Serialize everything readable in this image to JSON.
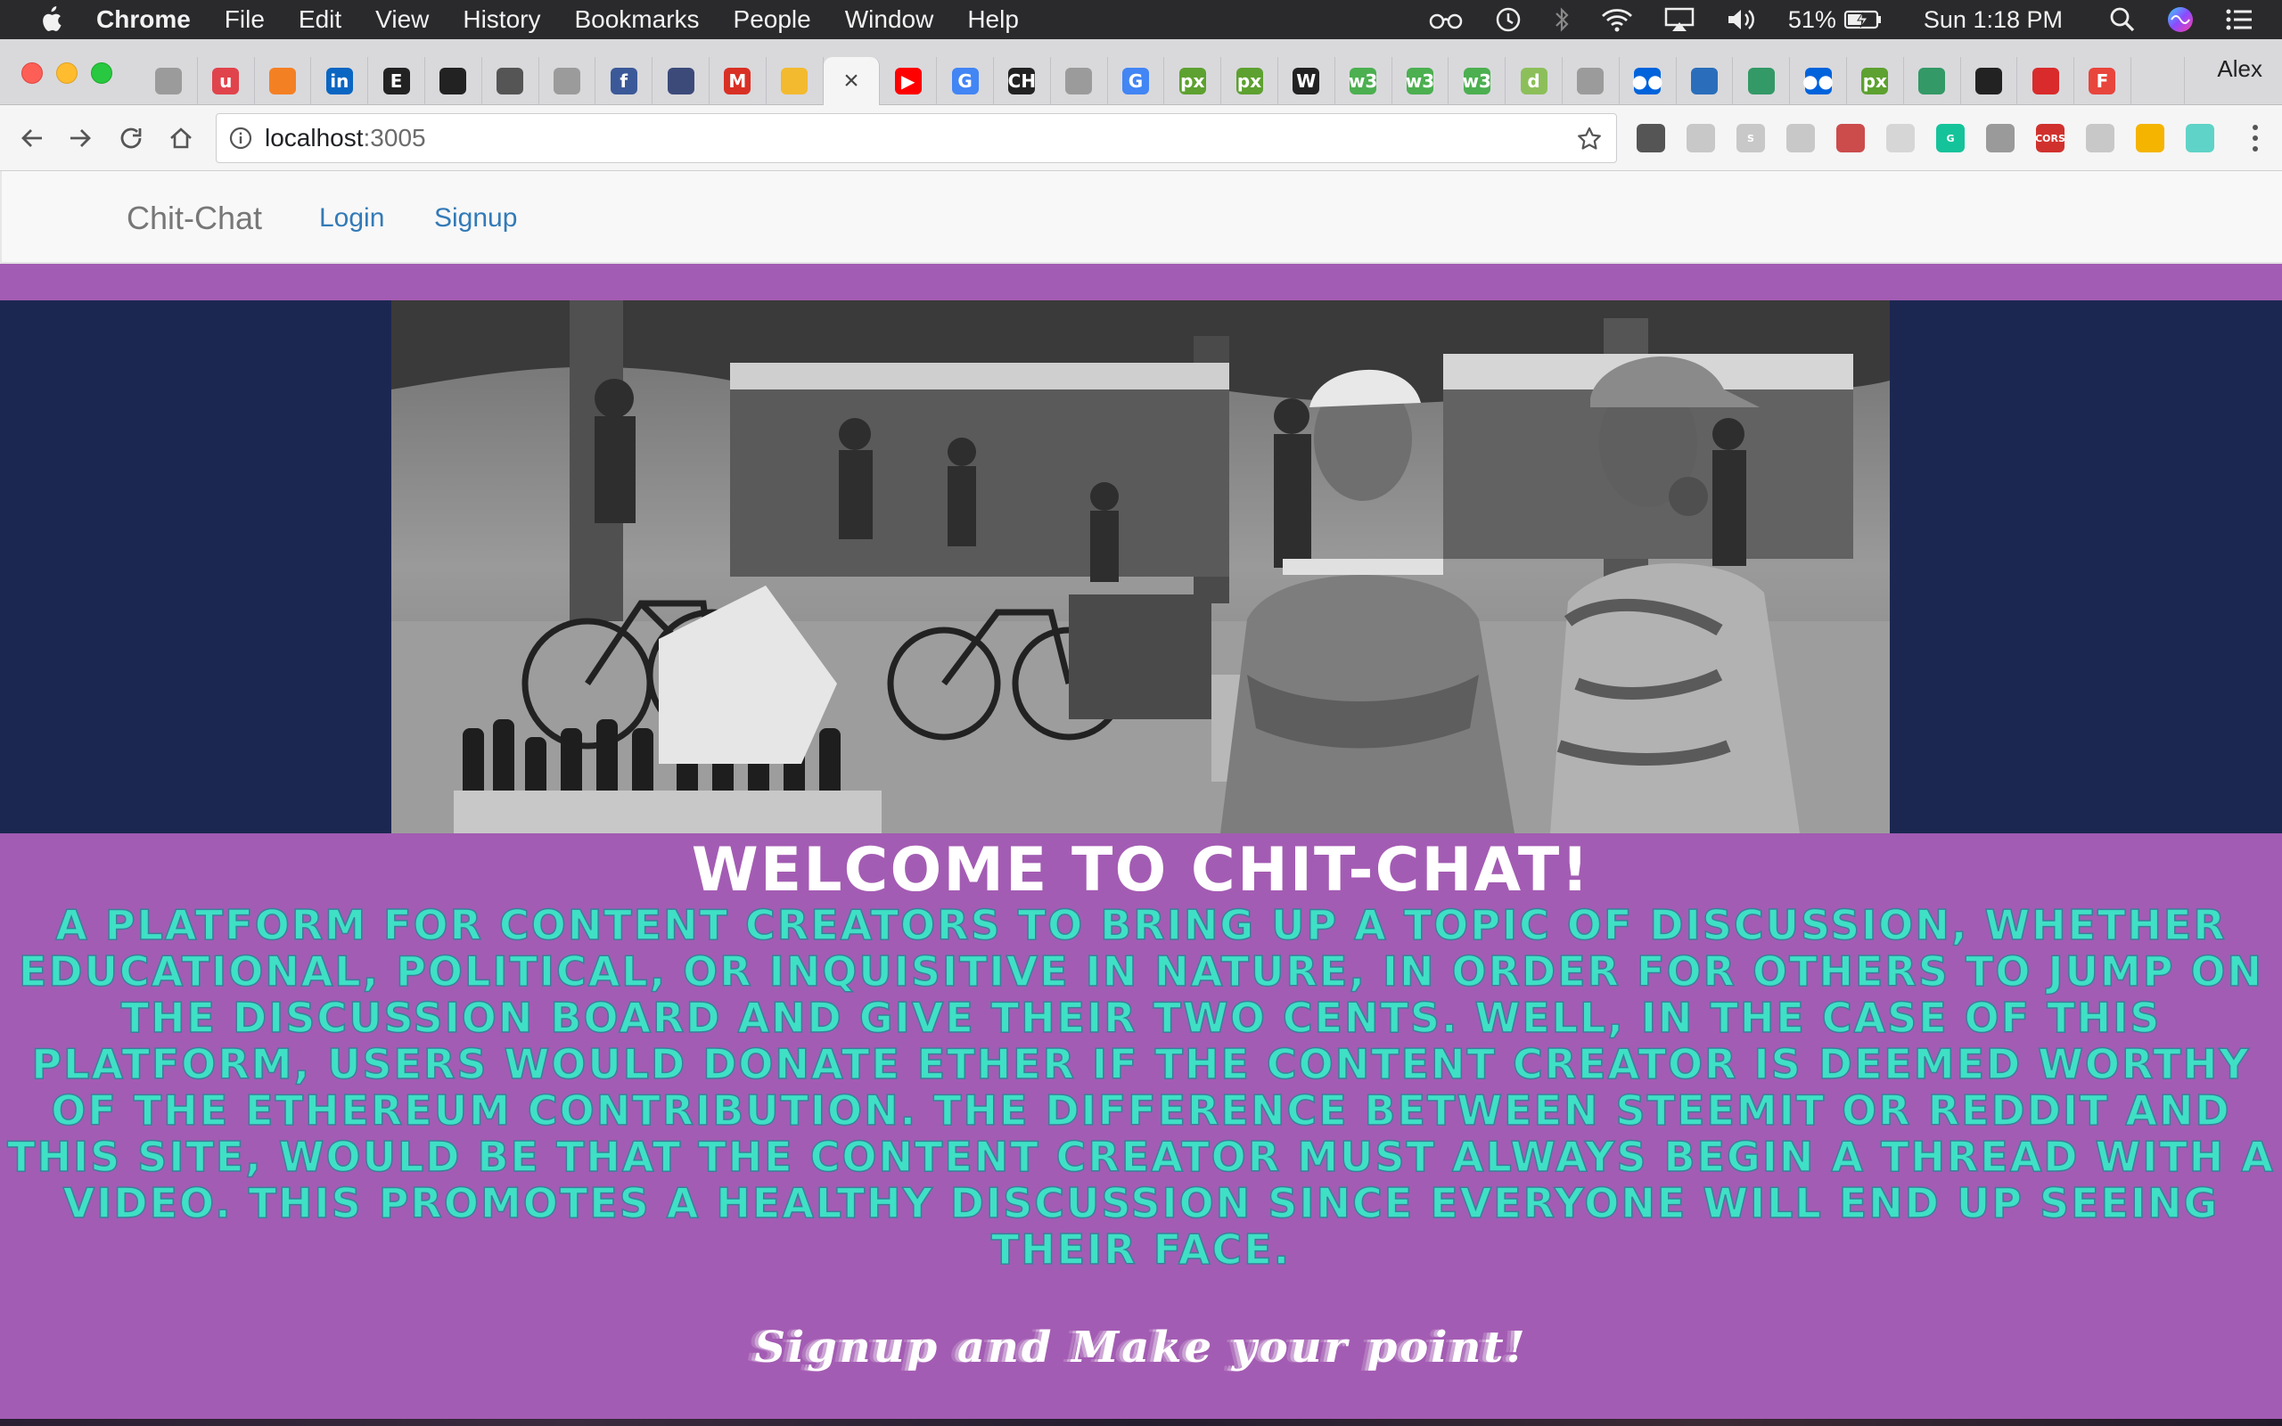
{
  "menubar": {
    "app_name": "Chrome",
    "items": [
      "File",
      "Edit",
      "View",
      "History",
      "Bookmarks",
      "People",
      "Window",
      "Help"
    ],
    "status": {
      "battery": "51%",
      "clock": "Sun 1:18 PM",
      "icons": [
        "glasses-icon",
        "time-machine-icon",
        "bluetooth-icon",
        "wifi-icon",
        "airplay-icon",
        "volume-icon",
        "battery-charging-icon",
        "spotlight-icon",
        "siri-icon",
        "notification-center-icon"
      ]
    }
  },
  "tabstrip": {
    "profile_name": "Alex",
    "active_close": "×",
    "tabs": [
      {
        "icon": "elephant-icon",
        "glyph": "",
        "color": "#9b9b9b"
      },
      {
        "icon": "u-icon",
        "glyph": "u",
        "color": "#e0434b"
      },
      {
        "icon": "stackoverflow-icon",
        "glyph": "",
        "color": "#f48024"
      },
      {
        "icon": "linkedin-icon",
        "glyph": "in",
        "color": "#0a66c2"
      },
      {
        "icon": "etsy-icon",
        "glyph": "E",
        "color": "#222222"
      },
      {
        "icon": "github-icon",
        "glyph": "",
        "color": "#222222"
      },
      {
        "icon": "pocket-icon",
        "glyph": "",
        "color": "#555555"
      },
      {
        "icon": "bird-icon",
        "glyph": "",
        "color": "#9b9b9b"
      },
      {
        "icon": "facebook-icon",
        "glyph": "f",
        "color": "#3b5998"
      },
      {
        "icon": "gauge-icon",
        "glyph": "",
        "color": "#3c4a7a"
      },
      {
        "icon": "gmail-icon",
        "glyph": "M",
        "color": "#d93025"
      },
      {
        "icon": "binance-icon",
        "glyph": "",
        "color": "#f3ba2f"
      },
      {
        "icon": "active-tab",
        "glyph": "",
        "color": "#f5f5f5"
      },
      {
        "icon": "youtube-icon",
        "glyph": "▶",
        "color": "#ff0000"
      },
      {
        "icon": "google-icon",
        "glyph": "G",
        "color": "#4285f4"
      },
      {
        "icon": "ch-icon",
        "glyph": "CH",
        "color": "#222222"
      },
      {
        "icon": "document-icon",
        "glyph": "",
        "color": "#9b9b9b"
      },
      {
        "icon": "google-icon",
        "glyph": "G",
        "color": "#4285f4"
      },
      {
        "icon": "px-icon",
        "glyph": "px",
        "color": "#5da130"
      },
      {
        "icon": "px-icon",
        "glyph": "px",
        "color": "#5da130"
      },
      {
        "icon": "wikipedia-icon",
        "glyph": "W",
        "color": "#222222"
      },
      {
        "icon": "w3-icon",
        "glyph": "w3",
        "color": "#4caf50"
      },
      {
        "icon": "w3-icon",
        "glyph": "w3",
        "color": "#4caf50"
      },
      {
        "icon": "w3-icon",
        "glyph": "w3",
        "color": "#4caf50"
      },
      {
        "icon": "d-icon",
        "glyph": "d",
        "color": "#8cbf5a"
      },
      {
        "icon": "document-icon",
        "glyph": "",
        "color": "#9b9b9b"
      },
      {
        "icon": "flickr-icon",
        "glyph": "●●",
        "color": "#0063dc"
      },
      {
        "icon": "card-icon",
        "glyph": "",
        "color": "#2a6ebb"
      },
      {
        "icon": "wikimedia-icon",
        "glyph": "",
        "color": "#339966"
      },
      {
        "icon": "flickr-icon",
        "glyph": "●●",
        "color": "#0063dc"
      },
      {
        "icon": "px-icon",
        "glyph": "px",
        "color": "#5da130"
      },
      {
        "icon": "wikimedia-icon",
        "glyph": "",
        "color": "#339966"
      },
      {
        "icon": "github-icon",
        "glyph": "",
        "color": "#222222"
      },
      {
        "icon": "red-stripe-icon",
        "glyph": "",
        "color": "#d92b2b"
      },
      {
        "icon": "f-icon",
        "glyph": "F",
        "color": "#e8453c"
      }
    ]
  },
  "toolbar": {
    "url_host": "localhost",
    "url_port": ":3005",
    "extensions": [
      {
        "icon": "cycle-icon",
        "glyph": "",
        "color": "#555555"
      },
      {
        "icon": "tree-icon",
        "glyph": "",
        "color": "#c8c8c8"
      },
      {
        "icon": "skype-icon",
        "glyph": "S",
        "color": "#c8c8c8"
      },
      {
        "icon": "cast-icon",
        "glyph": "",
        "color": "#c8c8c8"
      },
      {
        "icon": "puzzle-icon",
        "glyph": "",
        "color": "#cc4b4b"
      },
      {
        "icon": "square-icon",
        "glyph": "",
        "color": "#d6d6d6"
      },
      {
        "icon": "grammarly-icon",
        "glyph": "G",
        "color": "#15c39a"
      },
      {
        "icon": "vue-icon",
        "glyph": "",
        "color": "#9a9a9a"
      },
      {
        "icon": "cors-icon",
        "glyph": "CORS",
        "color": "#d0312d"
      },
      {
        "icon": "chat-icon",
        "glyph": "",
        "color": "#c8c8c8"
      },
      {
        "icon": "moon-icon",
        "glyph": "",
        "color": "#f5b400"
      },
      {
        "icon": "ring-icon",
        "glyph": "",
        "color": "#5fd3c7"
      }
    ]
  },
  "site": {
    "brand": "Chit-Chat",
    "nav": {
      "login": "Login",
      "signup": "Signup"
    },
    "colors": {
      "background": "#a35cb3",
      "hero": "#1c2751",
      "teal_text": "#3fe0c5"
    },
    "hero_image": "black-and-white street market photo with two men in the foreground",
    "welcome": "WELCOME TO CHIT-CHAT!",
    "description": "A platform for content creators to bring up a topic of discussion, whether educational, political, or inquisitive in nature, in order for others to jump on the discussion board and give their two cents. Well, in the case of this platform, users would donate ether if the content creator is deemed worthy of the Ethereum contribution. The difference between Steemit or Reddit and this site, would be that the content creator must always begin a thread with a video. This promotes a healthy discussion since everyone will end up seeing their face.",
    "cta": "Signup and Make your point!"
  }
}
